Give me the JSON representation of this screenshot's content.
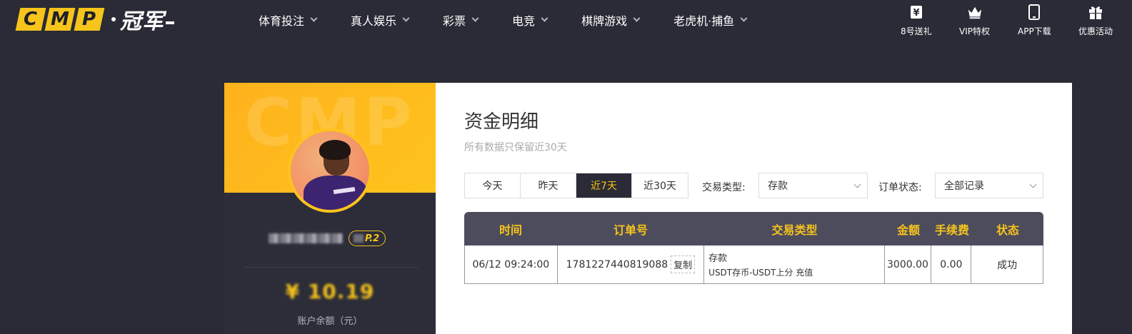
{
  "brand": {
    "logo_letters": [
      "C",
      "M",
      "P"
    ],
    "logo_cn": "冠军",
    "accent": "#f7c41b",
    "bg": "#2a2b36"
  },
  "nav": {
    "items": [
      {
        "label": "体育投注"
      },
      {
        "label": "真人娱乐"
      },
      {
        "label": "彩票"
      },
      {
        "label": "电竞"
      },
      {
        "label": "棋牌游戏"
      },
      {
        "label": "老虎机·捕鱼"
      }
    ]
  },
  "quick_links": [
    {
      "label": "8号送礼",
      "icon": "ticket-yen-icon"
    },
    {
      "label": "VIP特权",
      "icon": "crown-icon"
    },
    {
      "label": "APP下载",
      "icon": "phone-icon"
    },
    {
      "label": "优惠活动",
      "icon": "gift-icon"
    }
  ],
  "profile": {
    "watermark": "CMP",
    "vip_level": "P.2",
    "balance_label": "账户余额（元）",
    "balance_blurred": "¥ 10.19"
  },
  "page": {
    "title": "资金明细",
    "subtitle": "所有数据只保留近30天"
  },
  "filters": {
    "ranges": [
      "今天",
      "昨天",
      "近7天",
      "近30天"
    ],
    "active_range": "近7天",
    "type_label": "交易类型:",
    "type_value": "存款",
    "status_label": "订单状态:",
    "status_value": "全部记录"
  },
  "table": {
    "headers": [
      "时间",
      "订单号",
      "交易类型",
      "金额",
      "手续费",
      "状态"
    ],
    "rows": [
      {
        "time": "06/12 09:24:00",
        "order_no": "1781227440819088",
        "copy_label": "复制",
        "type_main": "存款",
        "type_detail": "USDT存币-USDT上分 充值",
        "amount": "3000.00",
        "fee": "0.00",
        "status": "成功"
      }
    ]
  }
}
